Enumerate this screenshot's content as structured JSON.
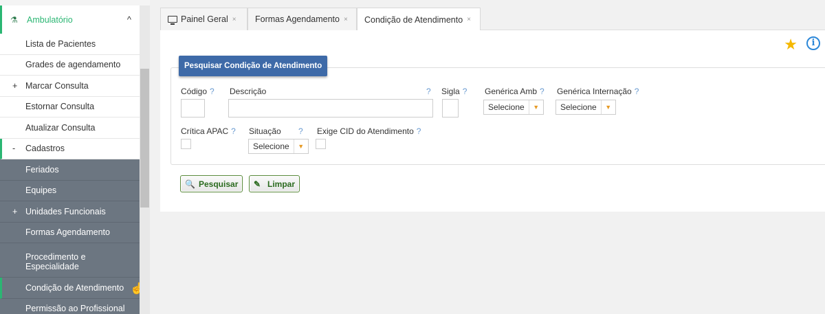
{
  "sidebar": {
    "header": {
      "label": "Ambulatório",
      "icon": "sitemap-icon",
      "chevron": "^"
    },
    "items": [
      {
        "label": "Lista de Pacientes"
      },
      {
        "label": "Grades de agendamento"
      },
      {
        "label": "Marcar Consulta",
        "sign": "+"
      },
      {
        "label": "Estornar Consulta"
      },
      {
        "label": "Atualizar Consulta"
      },
      {
        "label": "Cadastros",
        "sign": "-"
      }
    ],
    "sub_items": [
      {
        "label": "Feriados"
      },
      {
        "label": "Equipes"
      },
      {
        "label": "Unidades Funcionais",
        "sign": "+"
      },
      {
        "label": "Formas Agendamento"
      },
      {
        "label": "Procedimento e Especialidade"
      },
      {
        "label": "Condição de Atendimento"
      },
      {
        "label": "Permissão ao Profissional"
      }
    ]
  },
  "tabs": [
    {
      "label": "Painel Geral",
      "close": "×"
    },
    {
      "label": "Formas Agendamento",
      "close": "×"
    },
    {
      "label": "Condição de Atendimento",
      "close": "×"
    }
  ],
  "form": {
    "legend": "Pesquisar Condição de Atendimento",
    "help": "?",
    "codigo_label": "Código",
    "descricao_label": "Descrição",
    "sigla_label": "Sigla",
    "generica_amb_label": "Genérica Amb",
    "generica_internacao_label": "Genérica Internação",
    "critica_apac_label": "Crítica APAC",
    "situacao_label": "Situação",
    "exige_cid_label": "Exige CID do Atendimento",
    "select_value": "Selecione"
  },
  "buttons": {
    "search": "Pesquisar",
    "clear": "Limpar"
  },
  "colors": {
    "accent": "#2bb673",
    "legend_bg": "#3e6aa8",
    "dark_menu": "#6c7681",
    "star": "#f5b800",
    "info": "#2b87d8"
  }
}
